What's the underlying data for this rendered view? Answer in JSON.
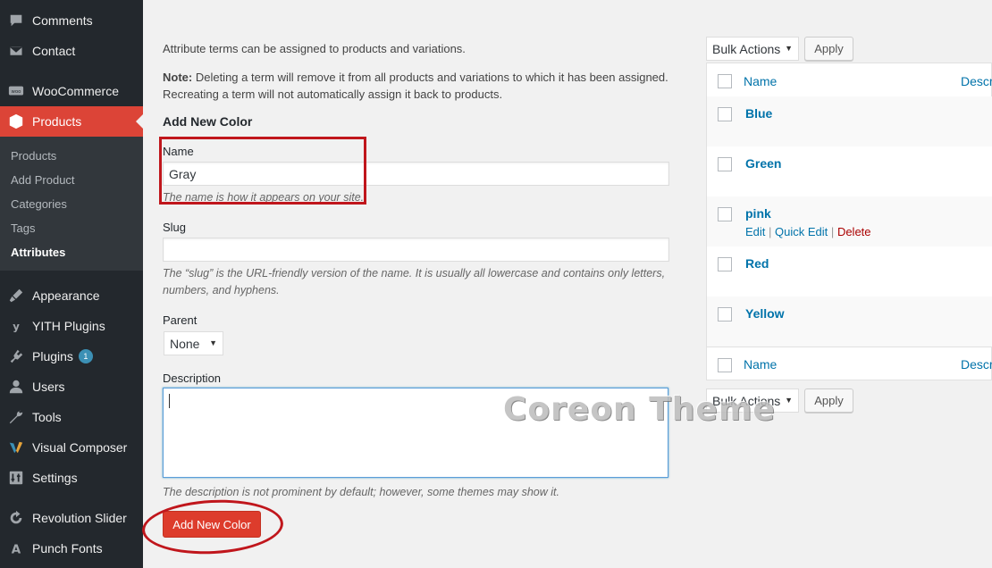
{
  "sidebar": {
    "items": [
      {
        "label": "Comments",
        "icon": "comment-icon"
      },
      {
        "label": "Contact",
        "icon": "mail-icon"
      },
      {
        "label": "WooCommerce",
        "icon": "woo-icon"
      },
      {
        "label": "Products",
        "icon": "box-icon"
      },
      {
        "label": "Appearance",
        "icon": "brush-icon"
      },
      {
        "label": "YITH Plugins",
        "icon": "yith-icon"
      },
      {
        "label": "Plugins",
        "icon": "plug-icon",
        "badge": "1"
      },
      {
        "label": "Users",
        "icon": "user-icon"
      },
      {
        "label": "Tools",
        "icon": "wrench-icon"
      },
      {
        "label": "Visual Composer",
        "icon": "vc-icon"
      },
      {
        "label": "Settings",
        "icon": "settings-icon"
      },
      {
        "label": "Revolution Slider",
        "icon": "refresh-icon"
      },
      {
        "label": "Punch Fonts",
        "icon": "font-icon"
      }
    ],
    "submenu": [
      "Products",
      "Add Product",
      "Categories",
      "Tags",
      "Attributes"
    ],
    "active_color": "#dc4437"
  },
  "form": {
    "intro": "Attribute terms can be assigned to products and variations.",
    "note_label": "Note:",
    "note_text": " Deleting a term will remove it from all products and variations to which it has been assigned. Recreating a term will not automatically assign it back to products.",
    "heading": "Add New Color",
    "name_label": "Name",
    "name_value": "Gray",
    "name_hint": "The name is how it appears on your site.",
    "slug_label": "Slug",
    "slug_value": "",
    "slug_hint": "The “slug” is the URL-friendly version of the name. It is usually all lowercase and contains only letters, numbers, and hyphens.",
    "parent_label": "Parent",
    "parent_value": "None",
    "description_label": "Description",
    "description_value": "",
    "description_hint": "The description is not prominent by default; however, some themes may show it.",
    "submit_label": "Add New Color"
  },
  "list": {
    "bulk_actions": "Bulk Actions",
    "apply": "Apply",
    "col_name": "Name",
    "col_desc": "Descr",
    "terms": [
      "Blue",
      "Green",
      "pink",
      "Red",
      "Yellow"
    ],
    "row_actions": {
      "edit": "Edit",
      "quick_edit": "Quick Edit",
      "delete": "Delete",
      "sep": "|"
    }
  },
  "watermark": "Coreon Theme"
}
